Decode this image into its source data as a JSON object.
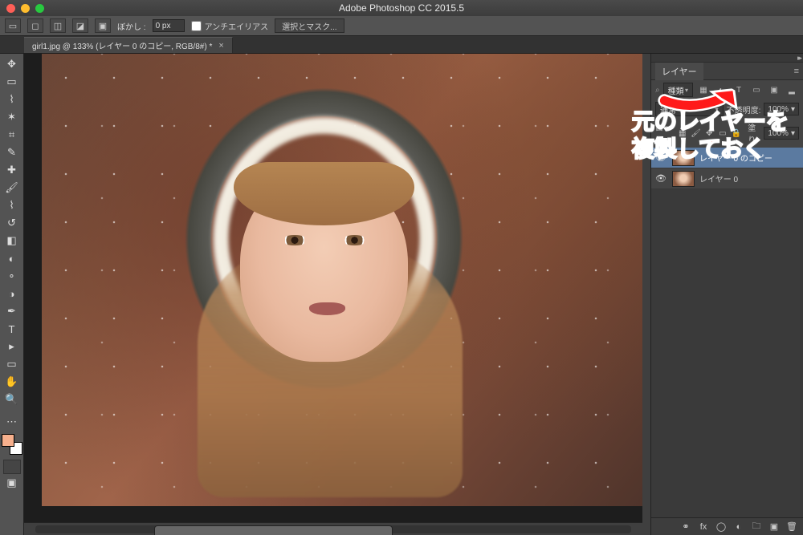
{
  "app_title": "Adobe Photoshop CC 2015.5",
  "options_bar": {
    "blur_label": "ぼかし :",
    "blur_value": "0 px",
    "antialias_label": "アンチエイリアス",
    "select_mask_label": "選択とマスク..."
  },
  "document_tab": {
    "title": "girl1.jpg @ 133% (レイヤー 0 のコピー, RGB/8#) *"
  },
  "layers_panel": {
    "title": "レイヤー",
    "kind_filter": "種類",
    "blend_mode": "通常",
    "opacity_label": "不透明度:",
    "opacity_value": "100%",
    "lock_label": "ロック:",
    "fill_label": "塗り:",
    "fill_value": "100%",
    "layers": [
      {
        "name": "レイヤー 0 のコピー",
        "visible": true,
        "selected": true
      },
      {
        "name": "レイヤー 0",
        "visible": true,
        "selected": false
      }
    ]
  },
  "annotation": {
    "line1": "元のレイヤーを",
    "line2": "複製しておく"
  }
}
